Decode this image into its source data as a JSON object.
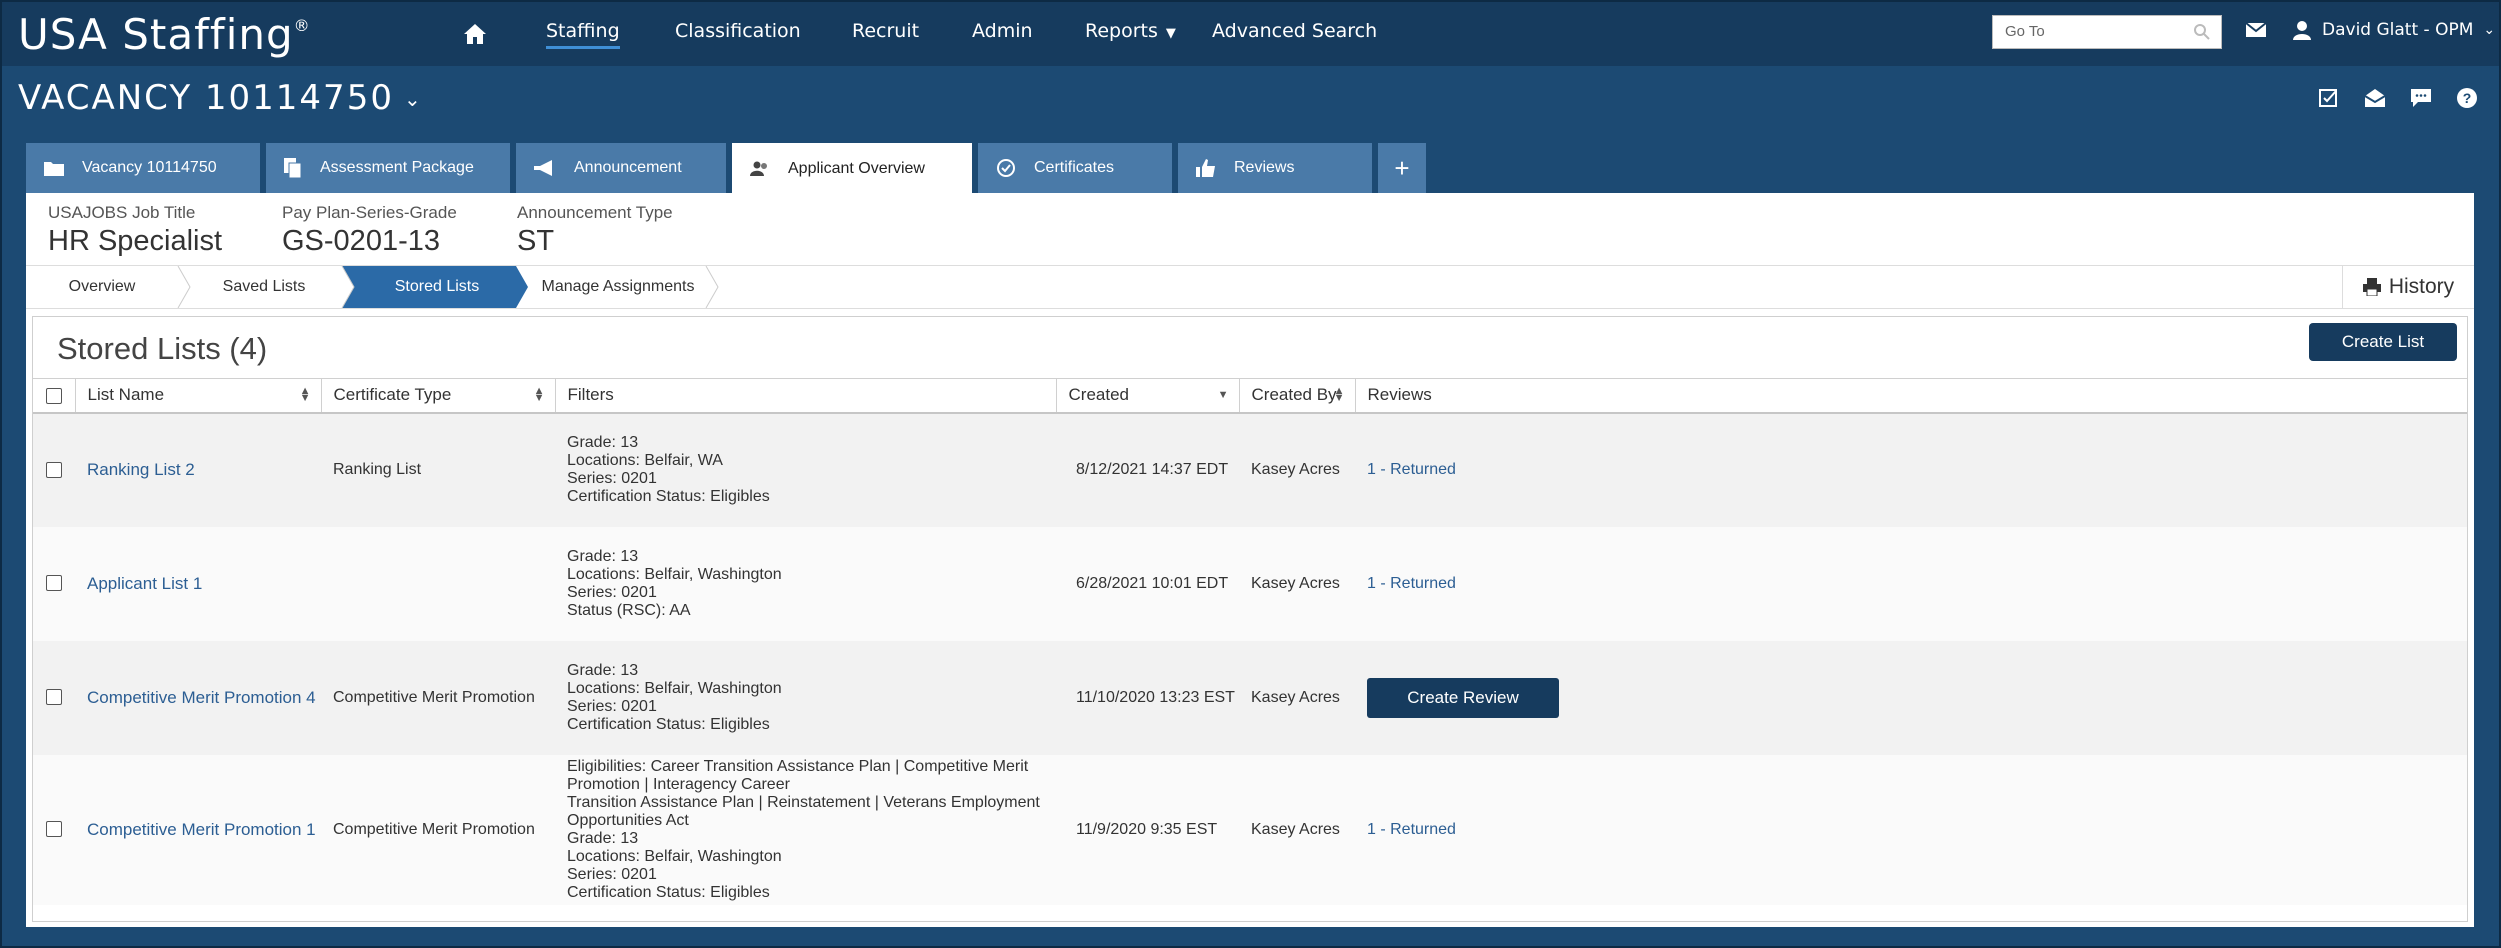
{
  "app": {
    "logo": "USA Staffing",
    "logo_mark": "®"
  },
  "nav": {
    "items": [
      "Staffing",
      "Classification",
      "Recruit",
      "Admin",
      "Reports",
      "Advanced Search"
    ],
    "goto_placeholder": "Go To",
    "user": "David Glatt - OPM"
  },
  "vacancy": {
    "title": "VACANCY 10114750"
  },
  "tabs": [
    {
      "label": "Vacancy 10114750",
      "icon": "folder-icon"
    },
    {
      "label": "Assessment Package",
      "icon": "documents-icon"
    },
    {
      "label": "Announcement",
      "icon": "megaphone-icon"
    },
    {
      "label": "Applicant Overview",
      "icon": "users-icon"
    },
    {
      "label": "Certificates",
      "icon": "check-circle-icon"
    },
    {
      "label": "Reviews",
      "icon": "thumbs-up-icon"
    }
  ],
  "meta": {
    "job_title_label": "USAJOBS Job Title",
    "job_title": "HR Specialist",
    "grade_label": "Pay Plan-Series-Grade",
    "grade": "GS-0201-13",
    "ann_type_label": "Announcement Type",
    "ann_type": "ST"
  },
  "steps": [
    "Overview",
    "Saved Lists",
    "Stored Lists",
    "Manage Assignments"
  ],
  "history_label": "History",
  "stored": {
    "title": "Stored Lists (4)",
    "create_label": "Create List",
    "headers": [
      "List Name",
      "Certificate Type",
      "Filters",
      "Created",
      "Created By",
      "Reviews"
    ],
    "rows": [
      {
        "name": "Ranking List 2",
        "cert": "Ranking List",
        "filters": [
          "Grade: 13",
          "Locations: Belfair, WA",
          "Series: 0201",
          "Certification Status: Eligibles"
        ],
        "created": "8/12/2021 14:37 EDT",
        "by": "Kasey Acres",
        "review": "1 - Returned"
      },
      {
        "name": "Applicant List 1",
        "cert": "",
        "filters": [
          "Grade: 13",
          "Locations: Belfair, Washington",
          "Series: 0201",
          "Status (RSC): AA"
        ],
        "created": "6/28/2021 10:01 EDT",
        "by": "Kasey Acres",
        "review": "1 - Returned"
      },
      {
        "name": "Competitive Merit Promotion 4",
        "cert": "Competitive Merit Promotion",
        "filters": [
          "Grade: 13",
          "Locations: Belfair, Washington",
          "Series: 0201",
          "Certification Status: Eligibles"
        ],
        "created": "11/10/2020 13:23 EST",
        "by": "Kasey Acres",
        "review_button": "Create Review"
      },
      {
        "name": "Competitive Merit Promotion 1",
        "cert": "Competitive Merit Promotion",
        "filters": [
          "Eligibilities: Career Transition Assistance Plan | Competitive Merit Promotion | Interagency Career",
          "Transition Assistance Plan | Reinstatement | Veterans Employment Opportunities Act",
          "Grade: 13",
          "Locations: Belfair, Washington",
          "Series: 0201",
          "Certification Status: Eligibles"
        ],
        "created": "11/9/2020 9:35 EST",
        "by": "Kasey Acres",
        "review": "1 - Returned"
      }
    ]
  }
}
